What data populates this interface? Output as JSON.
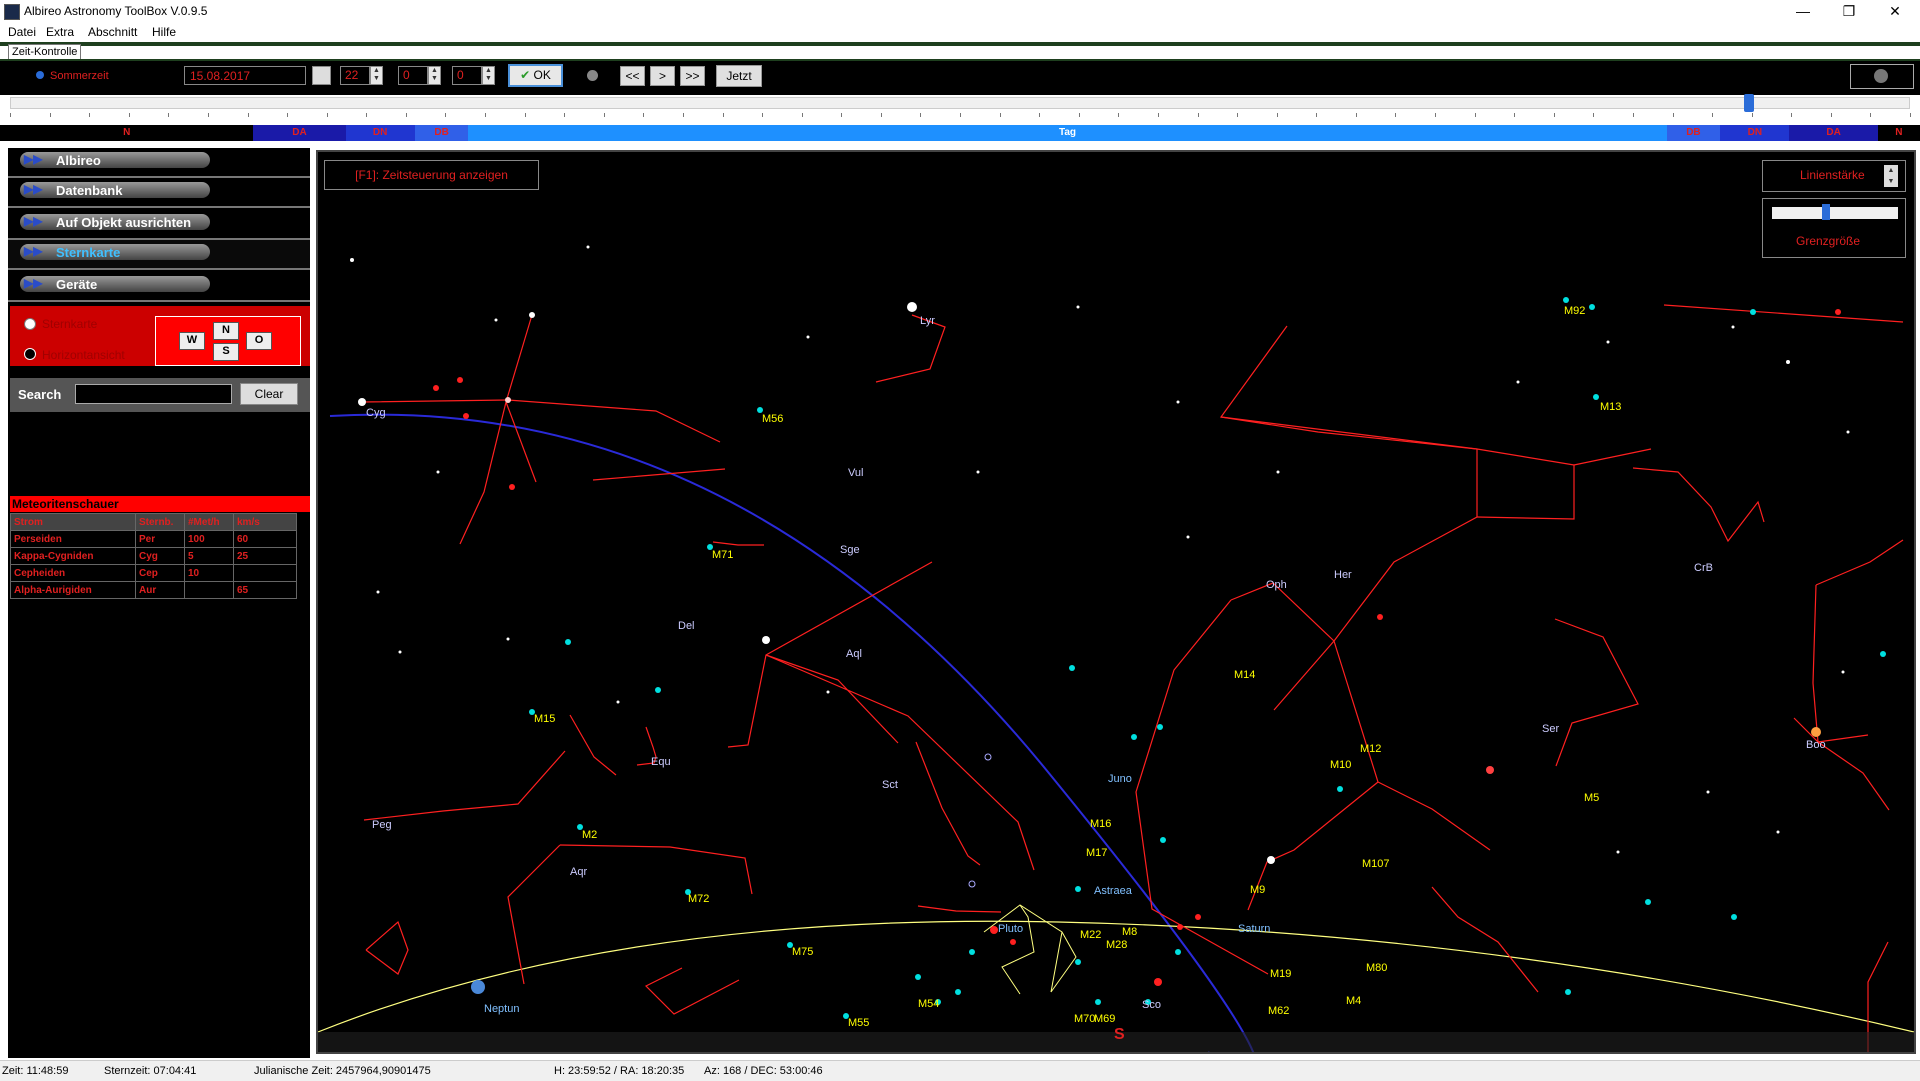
{
  "window": {
    "title": "Albireo Astronomy ToolBox V.0.9.5",
    "minimize": "—",
    "maximize": "❐",
    "close": "✕"
  },
  "menu": [
    "Datei",
    "Extra",
    "Abschnitt",
    "Hilfe"
  ],
  "time_control": {
    "tab_label": "Zeit-Kontrolle",
    "sommerzeit_label": "Sommerzeit",
    "date": "15.08.2017",
    "hour": "22",
    "minute": "0",
    "second": "0",
    "ok_label": "OK",
    "back_fast": "<<",
    "forward": ">",
    "forward_fast": ">>",
    "now_label": "Jetzt",
    "slider_position": 0.915
  },
  "day_bands": [
    {
      "label": "N",
      "from": 0.0,
      "to": 0.132,
      "color": "#000000",
      "text": "#e02020"
    },
    {
      "label": "DA",
      "from": 0.132,
      "to": 0.18,
      "color": "#1a1aa8",
      "text": "#e02020"
    },
    {
      "label": "DN",
      "from": 0.18,
      "to": 0.216,
      "color": "#2036d0",
      "text": "#e02020"
    },
    {
      "label": "DB",
      "from": 0.216,
      "to": 0.244,
      "color": "#3060e8",
      "text": "#e02020"
    },
    {
      "label": "Tag",
      "from": 0.244,
      "to": 0.868,
      "color": "#1e90ff",
      "text": "#ffffff"
    },
    {
      "label": "DB",
      "from": 0.868,
      "to": 0.896,
      "color": "#3060e8",
      "text": "#e02020"
    },
    {
      "label": "DN",
      "from": 0.896,
      "to": 0.932,
      "color": "#2036d0",
      "text": "#e02020"
    },
    {
      "label": "DA",
      "from": 0.932,
      "to": 0.978,
      "color": "#1a1aa8",
      "text": "#e02020"
    },
    {
      "label": "N",
      "from": 0.978,
      "to": 1.0,
      "color": "#000000",
      "text": "#e02020"
    }
  ],
  "sidebar": {
    "items": [
      {
        "label": "Albireo",
        "active": false
      },
      {
        "label": "Datenbank",
        "active": false
      },
      {
        "label": "Auf Objekt ausrichten",
        "active": false
      },
      {
        "label": "Sternkarte",
        "active": true
      },
      {
        "label": "Geräte",
        "active": false
      }
    ],
    "view_options": [
      "Sternkarte",
      "Horizontansicht"
    ],
    "compass": {
      "n": "N",
      "w": "W",
      "o": "O",
      "s": "S"
    },
    "search_label": "Search",
    "search_value": "",
    "clear_label": "Clear"
  },
  "meteors": {
    "title": "Meteoritenschauer",
    "columns": [
      "Strom",
      "Sternb.",
      "#Met/h",
      "km/s"
    ],
    "rows": [
      [
        "Perseiden",
        "Per",
        "100",
        "60"
      ],
      [
        "Kappa-Cygniden",
        "Cyg",
        "5",
        "25"
      ],
      [
        "Cepheiden",
        "Cep",
        "10",
        ""
      ],
      [
        "Alpha-Aurigiden",
        "Aur",
        "",
        "65"
      ]
    ]
  },
  "map": {
    "f1_label": "[F1]: Zeitsteuerung anzeigen",
    "linienstaerke_label": "Linienstärke",
    "grenzgroesse_label": "Grenzgröße",
    "grenzgroesse_value": 0.4,
    "south_label": "S",
    "constellation_labels": [
      "Lyr",
      "Cyg",
      "Vul",
      "Sge",
      "Del",
      "Aql",
      "Equ",
      "Peg",
      "Aqr",
      "Oph",
      "Her",
      "CrB",
      "Ser",
      "Boo",
      "Sct",
      "Sco"
    ],
    "messier_labels": [
      "M92",
      "M13",
      "M56",
      "M71",
      "M15",
      "M2",
      "M72",
      "M75",
      "M55",
      "M54",
      "M14",
      "M12",
      "M10",
      "M5",
      "M107",
      "M16",
      "M17",
      "M9",
      "M19",
      "M62",
      "M80",
      "M4",
      "M22",
      "M28",
      "M8",
      "M70",
      "M69"
    ],
    "planet_labels": [
      "Neptun",
      "Pluto",
      "Saturn",
      "Juno",
      "Astraea"
    ],
    "colors": {
      "constellation": "#ff2020",
      "ecliptic": "#ffff80",
      "galactic": "#2a2ad8",
      "messier": "#ffff00",
      "cluster": "#00e0e0"
    }
  },
  "status": {
    "zeit": "Zeit: 11:48:59",
    "sternzeit": "Sternzeit: 07:04:41",
    "julian": "Julianische Zeit: 2457964,90901475",
    "hra": "H: 23:59:52 / RA: 18:20:35",
    "azdec": "Az: 168 / DEC: 53:00:46"
  }
}
